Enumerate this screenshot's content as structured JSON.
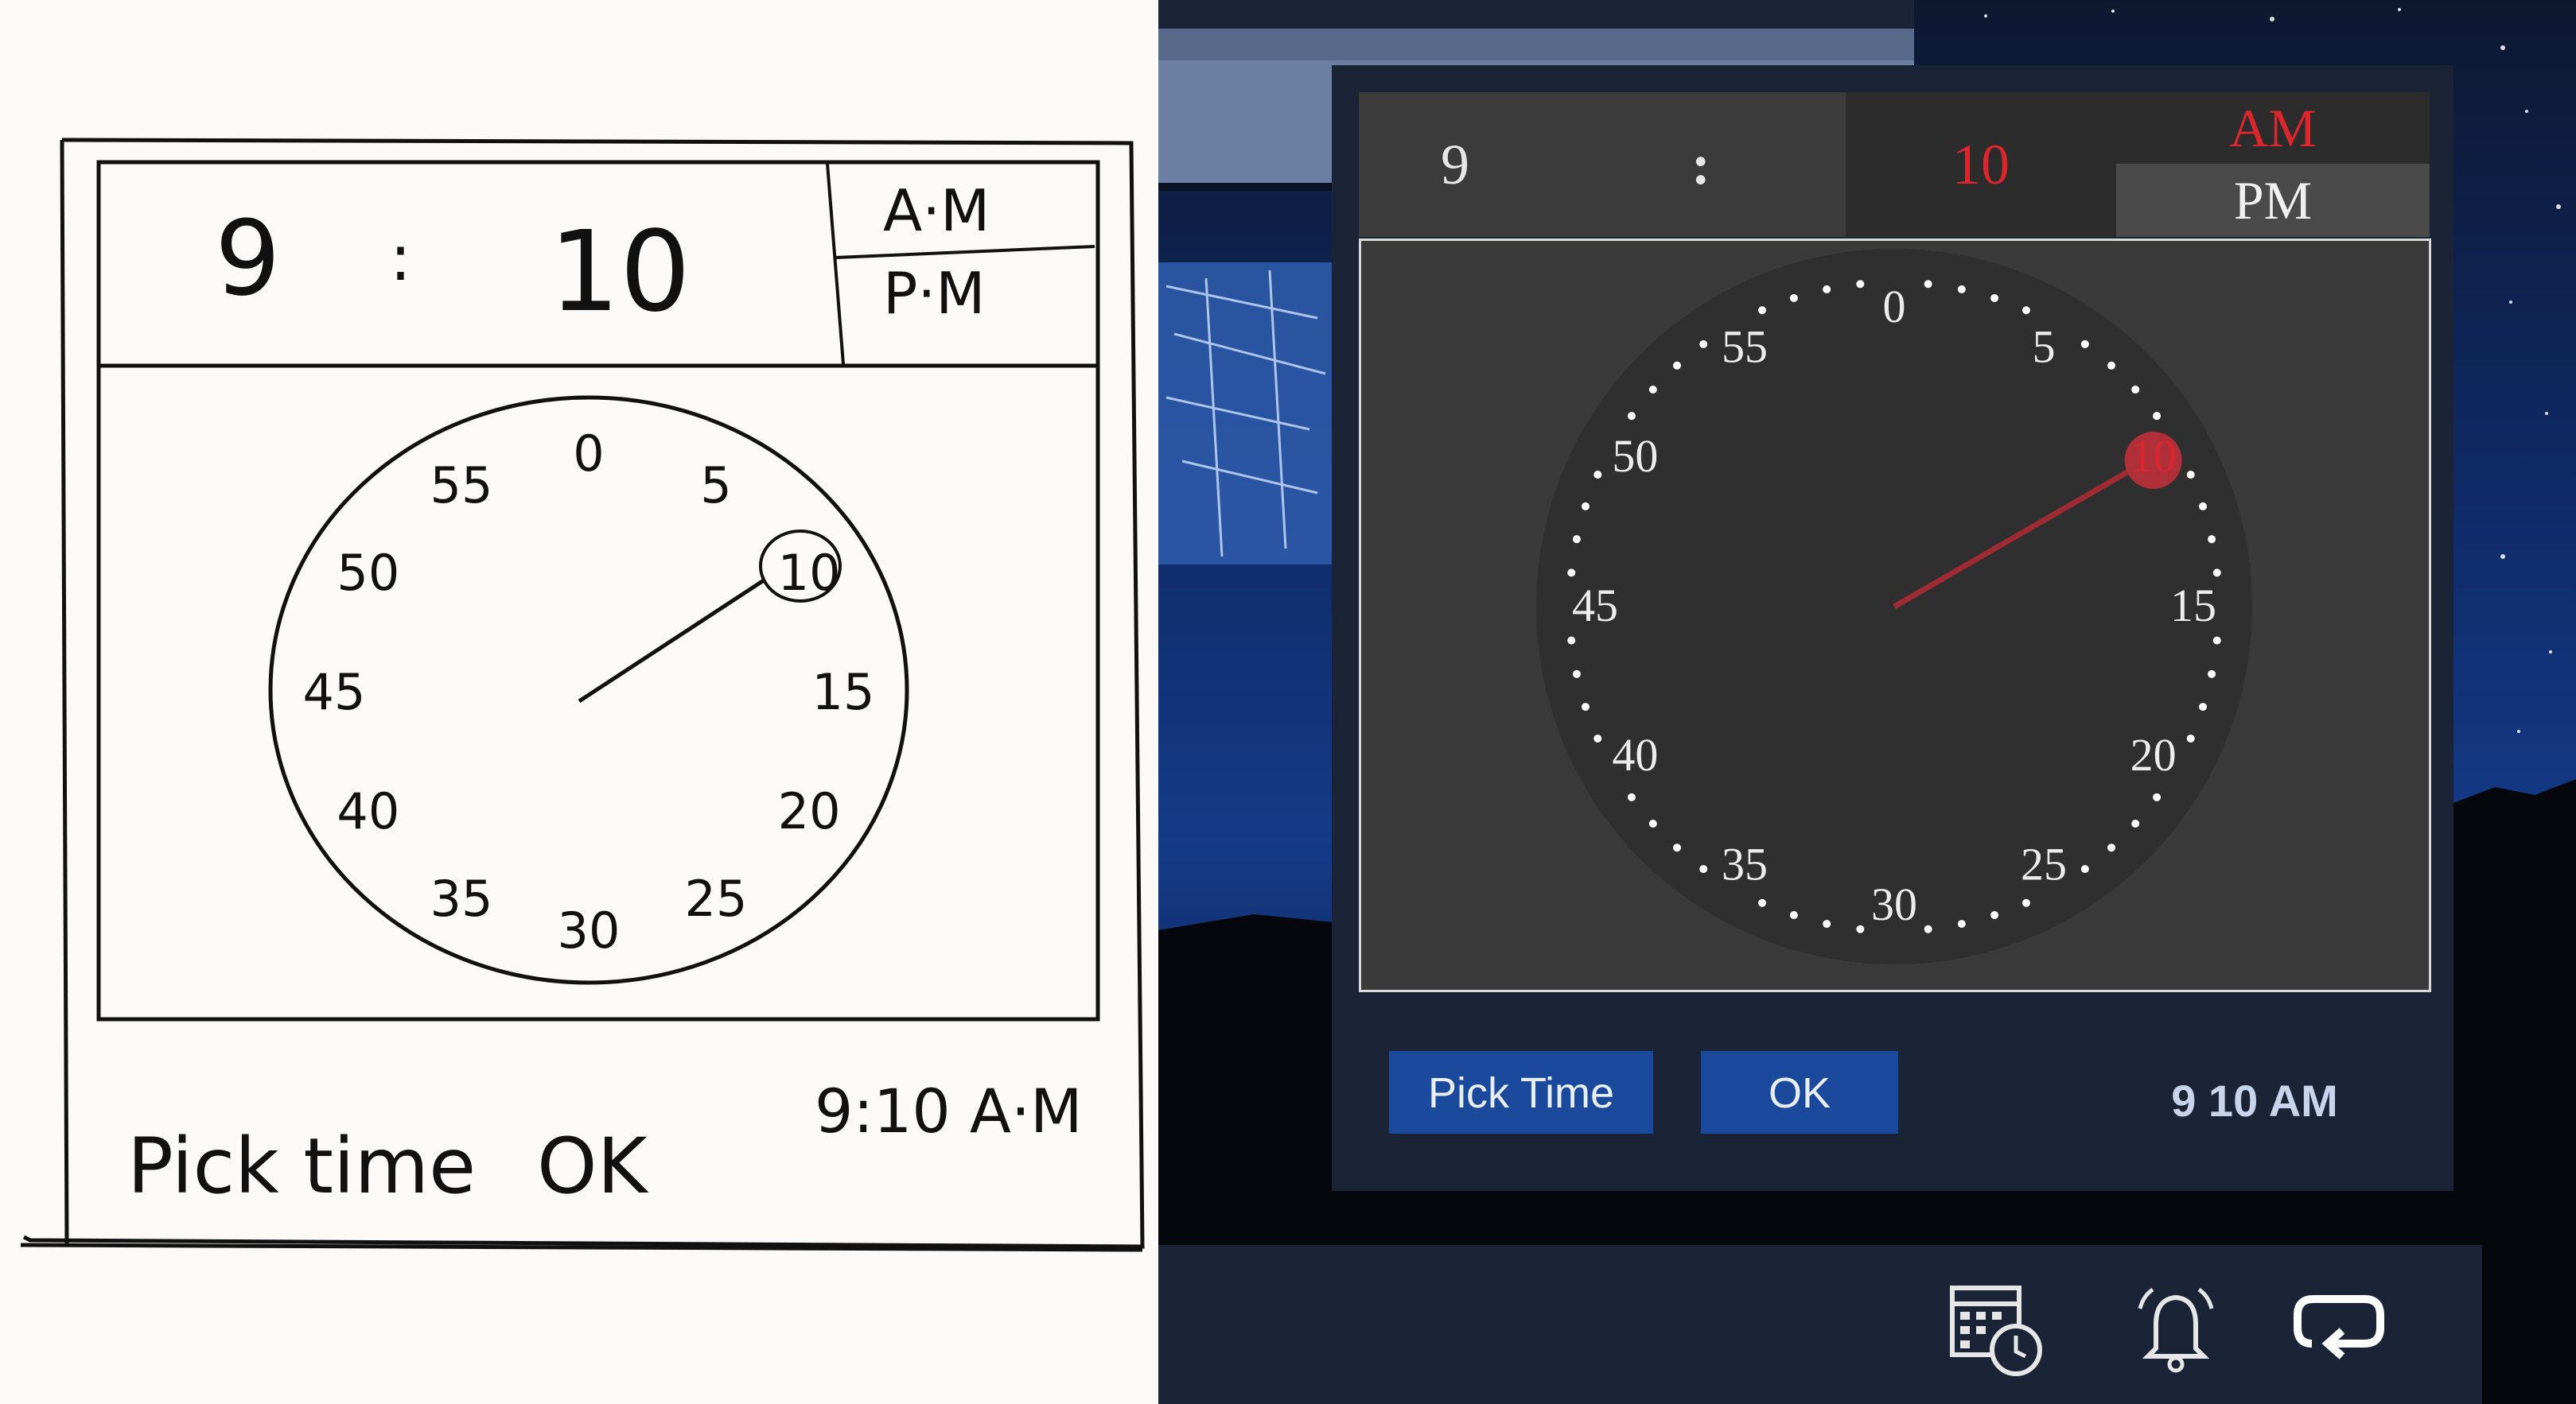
{
  "sketch": {
    "header": {
      "hour": "9",
      "colon": ":",
      "minute": "10",
      "am": "A·M",
      "pm": "P·M"
    },
    "dial_labels": [
      "0",
      "5",
      "10",
      "15",
      "20",
      "25",
      "30",
      "35",
      "40",
      "45",
      "50",
      "55"
    ],
    "pick_label": "Pick time",
    "ok_label": "OK",
    "result": "9:10 A·M"
  },
  "picker": {
    "hour": "9",
    "colon": ":",
    "minute": "10",
    "am_label": "AM",
    "pm_label": "PM",
    "selected_period": "AM",
    "selected_minute": 10,
    "dial_labels": [
      "0",
      "5",
      "10",
      "15",
      "20",
      "25",
      "30",
      "35",
      "40",
      "45",
      "50",
      "55"
    ],
    "pick_time_label": "Pick Time",
    "ok_label": "OK",
    "result": "9 10 AM"
  },
  "taskbar": {
    "icons": [
      "calendar-clock-icon",
      "bell-icon",
      "repeat-icon"
    ]
  },
  "colors": {
    "accent_red": "#d9262f",
    "button_blue": "#1b4a9c",
    "panel_bg": "#1a2436",
    "hand_color": "#9e2b33"
  }
}
